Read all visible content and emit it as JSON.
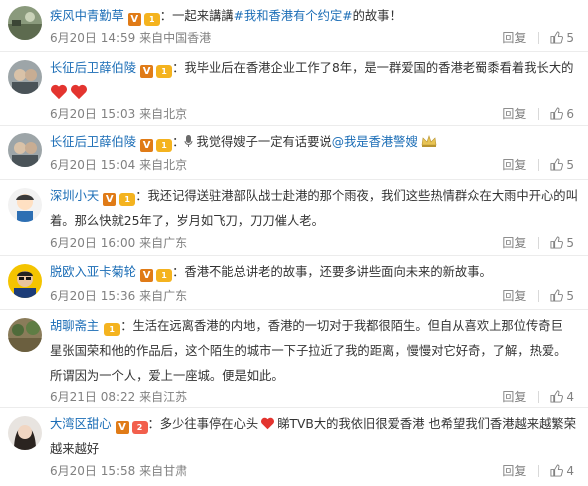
{
  "comments": [
    {
      "user": "疾风中青勤草",
      "level": "1",
      "text_before": "：一起来講講",
      "hashtag": "#我和香港有个约定#",
      "text_after": "的故事！",
      "timestamp": "6月20日 14:59 来自中国香港",
      "reply": "回复",
      "likes": "5"
    },
    {
      "user": "长征后卫薛伯陵",
      "level": "1",
      "text": "：我毕业后在香港企业工作了8年，是一群爱国的香港老蜀黍看着我长大的",
      "timestamp": "6月20日 15:03 来自北京",
      "reply": "回复",
      "likes": "6"
    },
    {
      "user": "长征后卫薛伯陵",
      "level": "1",
      "text_before": "：",
      "text_mid": "我觉得嫂子一定有话要说",
      "mention": "@我是香港警嫂",
      "timestamp": "6月20日 15:04 来自北京",
      "reply": "回复",
      "likes": "5"
    },
    {
      "user": "深圳小天",
      "level": "1",
      "text_line1": "：我还记得送驻港部队战士赴港的那个雨夜，我们这些热情群众在大雨中开心的叫",
      "text_line2": "着。那么快就25年了，岁月如飞刀，刀刀催人老。",
      "timestamp": "6月20日 16:00 来自广东",
      "reply": "回复",
      "likes": "5"
    },
    {
      "user": "脱欧入亚卡菊轮",
      "level": "1",
      "text": "：香港不能总讲老的故事，还要多讲些面向未来的新故事。",
      "timestamp": "6月20日 15:36 来自广东",
      "reply": "回复",
      "likes": "5"
    },
    {
      "user": "胡聊斋主",
      "level": "1",
      "text_line1": "：生活在远离香港的内地，香港的一切对于我都很陌生。但自从喜欢上那位传奇巨",
      "text_line2": "星张国荣和他的作品后，这个陌生的城市一下子拉近了我的距离，慢慢对它好奇，了解，热爱。",
      "text_line3": "所谓因为一个人，爱上一座城。便是如此。",
      "timestamp": "6月21日 08:22 来自江苏",
      "reply": "回复",
      "likes": "4"
    },
    {
      "user": "大湾区甜心",
      "level": "2",
      "text_before": "：多少往事停在心头",
      "text_after": "睇TVB大的我依旧很爱香港 也希望我们香港越来越繁荣",
      "text_line2": "越来越好",
      "timestamp": "6月20日 15:58 来自甘肃",
      "reply": "回复",
      "likes": "4"
    }
  ],
  "icons": {
    "verified": "v-badge",
    "level": "level-badge",
    "like": "thumbs-up-icon",
    "heart": "red-heart-emoji",
    "mic": "microphone-emoji",
    "crown": "crown-emoji"
  },
  "colors": {
    "username": "#1b6db6",
    "text": "#333333",
    "meta": "#808080",
    "verified_badge": "#e07b17",
    "level_badge": "#f4b31f",
    "heart": "#e3342f"
  }
}
